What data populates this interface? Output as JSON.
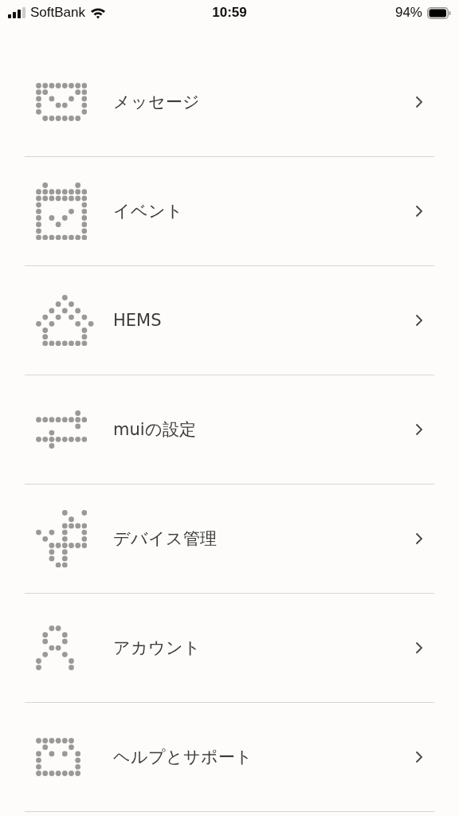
{
  "status_bar": {
    "carrier": "SoftBank",
    "time": "10:59",
    "battery": "94%"
  },
  "menu": [
    {
      "label": "メッセージ"
    },
    {
      "label": "イベント"
    },
    {
      "label": "HEMS"
    },
    {
      "label": "muiの設定"
    },
    {
      "label": "デバイス管理"
    },
    {
      "label": "アカウント"
    },
    {
      "label": "ヘルプとサポート"
    }
  ]
}
